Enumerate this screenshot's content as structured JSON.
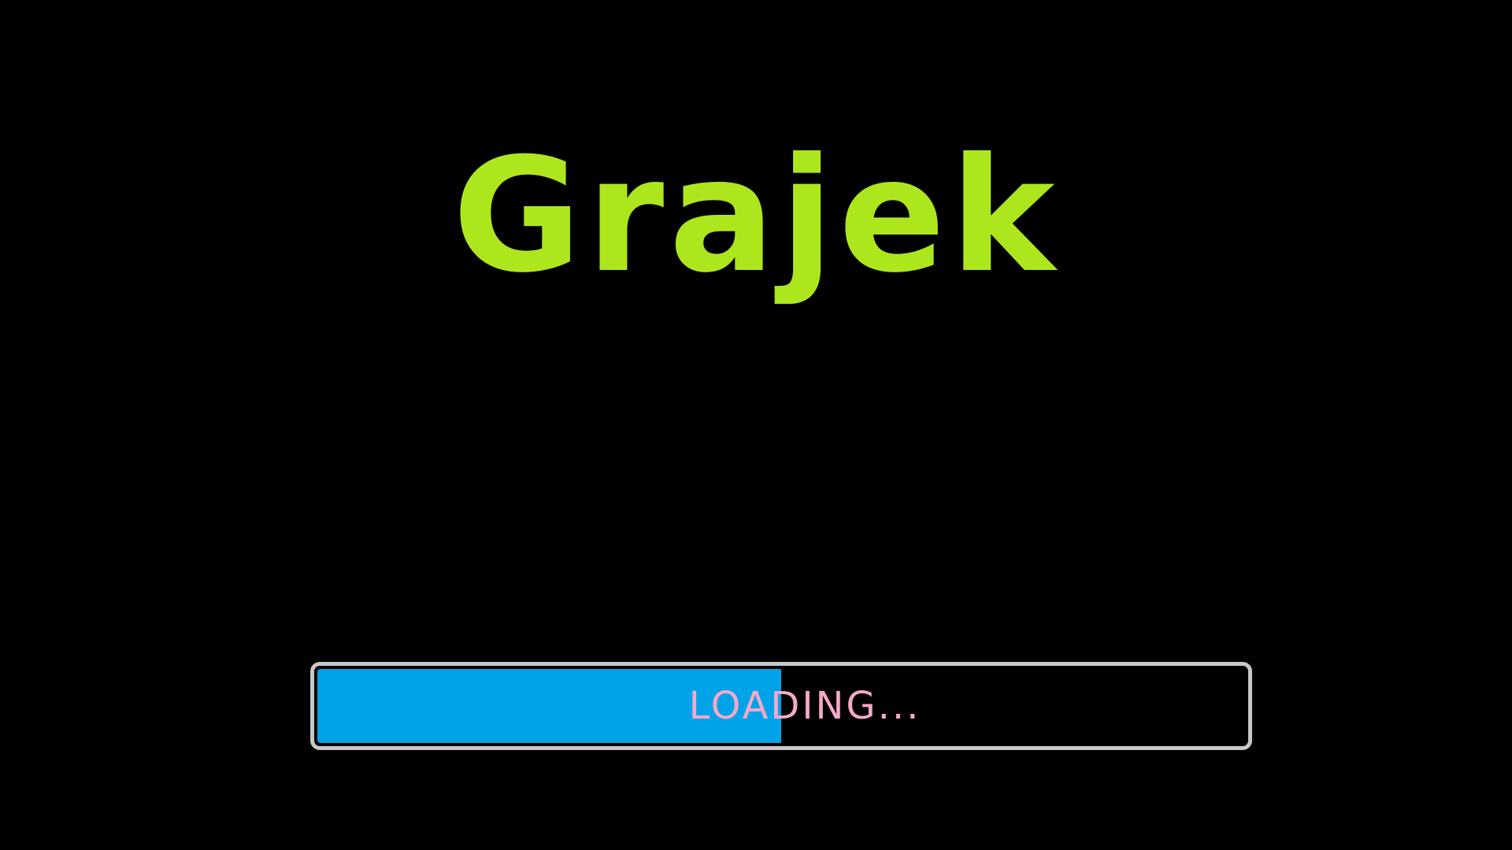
{
  "game": {
    "title": "Grajek"
  },
  "loading": {
    "label": "LOADING...",
    "progress_fraction": 0.5
  },
  "colors": {
    "background": "#000000",
    "title": "#aee61e",
    "bar_fill": "#00a2e8",
    "bar_border": "#c8c8c8",
    "label": "#f4a9c8"
  }
}
